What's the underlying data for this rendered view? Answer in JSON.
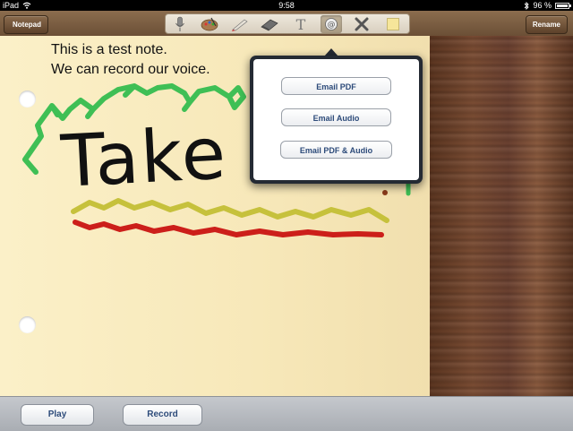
{
  "status_bar": {
    "device": "iPad",
    "time": "9:58",
    "battery": "96 %",
    "battery_level": 0.96
  },
  "toolbar": {
    "back_label": "Notepad",
    "rename_label": "Rename",
    "tools": [
      {
        "name": "microphone-icon"
      },
      {
        "name": "paint-palette-icon"
      },
      {
        "name": "pen-icon"
      },
      {
        "name": "eraser-icon"
      },
      {
        "name": "text-icon",
        "glyph": "T"
      },
      {
        "name": "email-icon",
        "active": true
      },
      {
        "name": "delete-icon"
      },
      {
        "name": "sticky-note-icon"
      }
    ]
  },
  "note": {
    "line1": "This is a test note.",
    "line2": "We can record our voice.",
    "handwriting": "Take me"
  },
  "popover": {
    "email_pdf": "Email PDF",
    "email_audio": "Email Audio",
    "email_pdf_audio": "Email PDF & Audio"
  },
  "bottom_bar": {
    "play_label": "Play",
    "record_label": "Record"
  },
  "colors": {
    "green_stroke": "#3fbf55",
    "black_stroke": "#111111",
    "yellow_stroke": "#c6c13c",
    "red_stroke": "#cc1f1a",
    "wood": "#6a4030",
    "paper": "#f7e8b9"
  }
}
